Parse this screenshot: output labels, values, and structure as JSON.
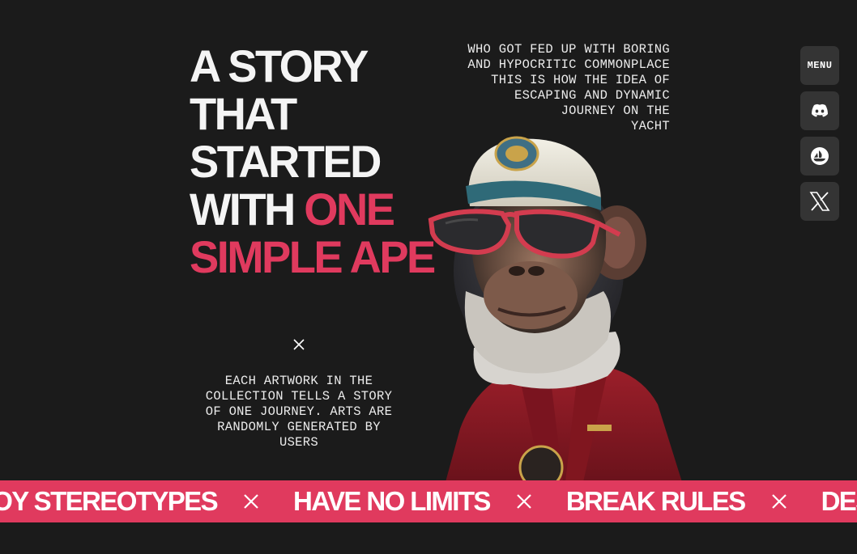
{
  "headline": {
    "line1": "A STORY",
    "line2": "THAT",
    "line3": "STARTED",
    "line4_white": "WITH ",
    "line4_accent": "ONE",
    "line5_accent": "SIMPLE APE"
  },
  "top_right_text": [
    "WHO GOT FED UP WITH BORING",
    "AND HYPOCRITIC COMMONPLACE",
    "THIS IS HOW THE IDEA OF",
    "ESCAPING AND DYNAMIC",
    "JOURNEY ON THE",
    "YACHT"
  ],
  "bottom_text": [
    "EACH ARTWORK IN THE",
    "COLLECTION TELLS A STORY",
    "OF ONE JOURNEY. ARTS ARE",
    "RANDOMLY GENERATED BY",
    "USERS"
  ],
  "side_menu": {
    "menu_label": "MENU",
    "icons": [
      "discord-icon",
      "opensea-icon",
      "x-twitter-icon"
    ]
  },
  "ticker": [
    "ROY STEREOTYPES",
    "HAVE NO LIMITS",
    "BREAK RULES",
    "DESTROY ST"
  ],
  "colors": {
    "background": "#1b1b1b",
    "accent": "#e03a5e",
    "button_bg": "#343434",
    "text": "#f4f4f4"
  }
}
